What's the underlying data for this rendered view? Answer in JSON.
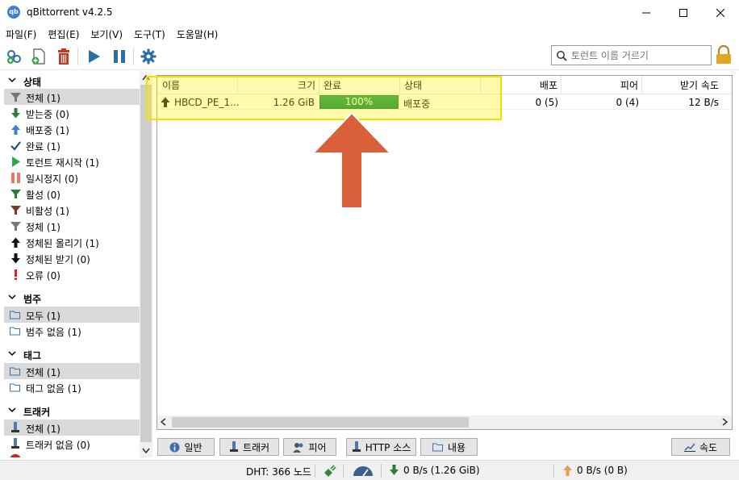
{
  "window": {
    "title": "qBittorrent v4.2.5",
    "app_icon_text": "qb"
  },
  "menu": [
    "파일(F)",
    "편집(E)",
    "보기(V)",
    "도구(T)",
    "도움말(H)"
  ],
  "search": {
    "placeholder": "토런트 이름 거르기"
  },
  "sidebar": {
    "status_header": "상태",
    "status_items": [
      {
        "label": "전체 (1)",
        "icon": "funnel-icon"
      },
      {
        "label": "받는중 (0)",
        "icon": "down-arrow-icon"
      },
      {
        "label": "배포중 (1)",
        "icon": "up-arrow-icon"
      },
      {
        "label": "완료 (1)",
        "icon": "checkmark-icon"
      },
      {
        "label": "토런트 재시작 (1)",
        "icon": "play-icon"
      },
      {
        "label": "일시정지 (0)",
        "icon": "pause-icon"
      },
      {
        "label": "활성 (0)",
        "icon": "funnel-icon"
      },
      {
        "label": "비활성 (1)",
        "icon": "funnel-icon"
      },
      {
        "label": "정체 (1)",
        "icon": "funnel-icon"
      },
      {
        "label": "정체된 올리기 (1)",
        "icon": "up-arrow-icon"
      },
      {
        "label": "정체된 받기 (0)",
        "icon": "down-arrow-icon"
      },
      {
        "label": "오류 (0)",
        "icon": "exclamation-icon"
      }
    ],
    "category_header": "범주",
    "category_items": [
      {
        "label": "모두 (1)",
        "icon": "folder-icon"
      },
      {
        "label": "범주 없음 (1)",
        "icon": "folder-icon"
      }
    ],
    "tags_header": "태그",
    "tags_items": [
      {
        "label": "전체 (1)",
        "icon": "folder-icon"
      },
      {
        "label": "태그 없음 (1)",
        "icon": "folder-icon"
      }
    ],
    "trackers_header": "트래커",
    "trackers_items": [
      {
        "label": "전체 (1)",
        "icon": "tracker-icon"
      },
      {
        "label": "트래커 없음 (0)",
        "icon": "tracker-icon"
      }
    ]
  },
  "table": {
    "columns": [
      "이름",
      "크기",
      "완료",
      "상태",
      "배포",
      "피어",
      "받기 속도"
    ],
    "rows": [
      {
        "name": "HBCD_PE_1...",
        "size": "1.26 GiB",
        "progress": "100%",
        "progress_fraction": 1.0,
        "status": "배포중",
        "seeds": "0 (5)",
        "peers": "0 (4)",
        "down_speed": "12 B/s"
      }
    ]
  },
  "bottom_tabs": [
    "일반",
    "트래커",
    "피어",
    "HTTP 소스",
    "내용"
  ],
  "speed_button": "속도",
  "statusbar": {
    "dht": "DHT: 366 노드",
    "download": "0 B/s (1.26 GiB)",
    "upload": "0 B/s (0 B)"
  },
  "colors": {
    "accent_red": "#d9603b",
    "progress_green": "#0f9550",
    "highlight_yellow": "#f0e000",
    "tool_blue": "#2d6ea3",
    "delete_red": "#c0392b"
  }
}
